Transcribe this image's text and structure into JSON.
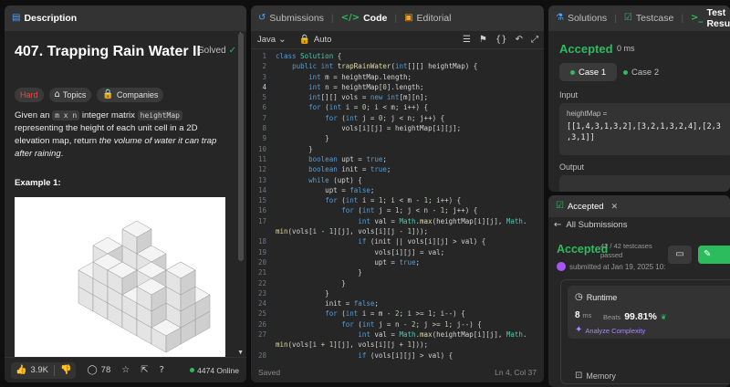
{
  "left": {
    "tab_label": "Description",
    "title": "407. Trapping Rain Water II",
    "solved_label": "Solved",
    "tags": {
      "difficulty": "Hard",
      "topics": "Topics",
      "companies": "Companies"
    },
    "desc": {
      "p1": "Given an ",
      "code1": "m x n",
      "p2": " integer matrix ",
      "code2": "heightMap",
      "p3": " representing the height of each unit cell in a 2D elevation map, return ",
      "p4": "the volume of water it can trap after raining",
      "p5": "."
    },
    "example_label": "Example 1:",
    "footer": {
      "likes": "3.9K",
      "comments": "78",
      "online": "4474 Online"
    }
  },
  "mid": {
    "tabs": {
      "submissions": "Submissions",
      "code": "Code",
      "editorial": "Editorial"
    },
    "language": "Java",
    "auto": "Auto",
    "status_saved": "Saved",
    "cursor_pos": "Ln 4, Col 37",
    "current_line": 4,
    "code_lines": [
      {
        "n": "1",
        "t": "class Solution {"
      },
      {
        "n": "2",
        "t": "    public int trapRainWater(int[][] heightMap) {"
      },
      {
        "n": "3",
        "t": "        int m = heightMap.length;"
      },
      {
        "n": "4",
        "t": "        int n = heightMap[0].length;"
      },
      {
        "n": "5",
        "t": "        int[][] vols = new int[m][n];"
      },
      {
        "n": "6",
        "t": "        for (int i = 0; i < m; i++) {"
      },
      {
        "n": "7",
        "t": "            for (int j = 0; j < n; j++) {"
      },
      {
        "n": "8",
        "t": "                vols[i][j] = heightMap[i][j];"
      },
      {
        "n": "9",
        "t": "            }"
      },
      {
        "n": "10",
        "t": "        }"
      },
      {
        "n": "11",
        "t": "        boolean upt = true;"
      },
      {
        "n": "12",
        "t": "        boolean init = true;"
      },
      {
        "n": "13",
        "t": "        while (upt) {"
      },
      {
        "n": "14",
        "t": "            upt = false;"
      },
      {
        "n": "15",
        "t": "            for (int i = 1; i < m - 1; i++) {"
      },
      {
        "n": "16",
        "t": "                for (int j = 1; j < n - 1; j++) {"
      },
      {
        "n": "17",
        "t": "                    int val = Math.max(heightMap[i][j], Math."
      },
      {
        "n": "",
        "t": "min(vols[i - 1][j], vols[i][j - 1]));"
      },
      {
        "n": "18",
        "t": "                    if (init || vols[i][j] > val) {"
      },
      {
        "n": "19",
        "t": "                        vols[i][j] = val;"
      },
      {
        "n": "20",
        "t": "                        upt = true;"
      },
      {
        "n": "21",
        "t": "                    }"
      },
      {
        "n": "22",
        "t": "                }"
      },
      {
        "n": "23",
        "t": "            }"
      },
      {
        "n": "24",
        "t": "            init = false;"
      },
      {
        "n": "25",
        "t": "            for (int i = m - 2; i >= 1; i--) {"
      },
      {
        "n": "26",
        "t": "                for (int j = n - 2; j >= 1; j--) {"
      },
      {
        "n": "27",
        "t": "                    int val = Math.max(heightMap[i][j], Math."
      },
      {
        "n": "",
        "t": "min(vols[i + 1][j], vols[i][j + 1]));"
      },
      {
        "n": "28",
        "t": "                    if (vols[i][j] > val) {"
      }
    ]
  },
  "right": {
    "tabs": {
      "solutions": "Solutions",
      "testcase": "Testcase",
      "result": "Test Result"
    },
    "result_status": "Accepted",
    "result_time": "0 ms",
    "cases": [
      "Case 1",
      "Case 2"
    ],
    "input_label": "Input",
    "input_name": "heightMap =",
    "input_value_l1": "[[1,4,3,1,3,2],[3,2,1,3,2,4],[2,3",
    "input_value_l2": ",3,1]]",
    "output_label": "Output",
    "sub": {
      "tab": "Accepted",
      "back": "All Submissions",
      "status": "Accepted",
      "passed": "42 / 42 testcases passed",
      "submitted": "submitted at Jan 19, 2025 10:",
      "runtime_label": "Runtime",
      "runtime_value": "8",
      "runtime_unit": "ms",
      "beats_label": "Beats",
      "beats_value": "99.81%",
      "analyze": "Analyze Complexity",
      "memory_label": "Memory"
    }
  },
  "colors": {
    "accent_green": "#2cbb5d",
    "hard_red": "#ef4743",
    "water_blue": "#3d7fd6",
    "panel_bg": "#262626"
  }
}
